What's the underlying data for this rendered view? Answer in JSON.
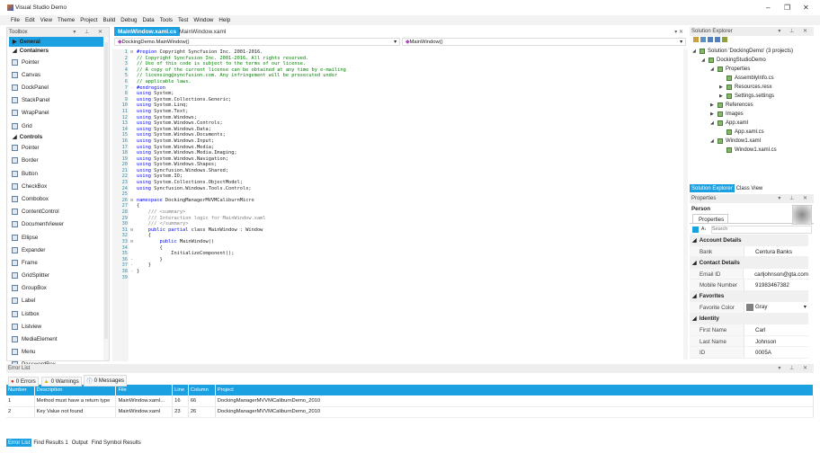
{
  "window": {
    "title": "Visual Studio Demo",
    "controls": [
      "–",
      "❐",
      "✕"
    ]
  },
  "menu": [
    "File",
    "Edit",
    "View",
    "Theme",
    "Project",
    "Build",
    "Debug",
    "Data",
    "Tools",
    "Test",
    "Window",
    "Help"
  ],
  "toolbox": {
    "title": "Toolbox",
    "items": [
      {
        "kind": "sel",
        "label": "General"
      },
      {
        "kind": "cat",
        "label": "Containers"
      },
      {
        "label": "Pointer",
        "icon": "pointer-icon"
      },
      {
        "label": "Canvas",
        "icon": "canvas-icon"
      },
      {
        "label": "DockPanel",
        "icon": "dockpanel-icon"
      },
      {
        "label": "StackPanel",
        "icon": "stackpanel-icon"
      },
      {
        "label": "WrapPanel",
        "icon": "wrappanel-icon"
      },
      {
        "label": "Grid",
        "icon": "grid-icon"
      },
      {
        "kind": "cat",
        "label": "Controls"
      },
      {
        "label": "Pointer",
        "icon": "pointer-icon"
      },
      {
        "label": "Border",
        "icon": "border-icon"
      },
      {
        "label": "Button",
        "icon": "button-icon"
      },
      {
        "label": "CheckBox",
        "icon": "checkbox-icon"
      },
      {
        "label": "Combobox",
        "icon": "combobox-icon"
      },
      {
        "label": "ContentControl",
        "icon": "contentcontrol-icon"
      },
      {
        "label": "DocumentViewer",
        "icon": "documentviewer-icon"
      },
      {
        "label": "Ellipse",
        "icon": "ellipse-icon"
      },
      {
        "label": "Expander",
        "icon": "expander-icon"
      },
      {
        "label": "Frame",
        "icon": "frame-icon"
      },
      {
        "label": "GridSplitter",
        "icon": "gridsplitter-icon"
      },
      {
        "label": "GroupBox",
        "icon": "groupbox-icon"
      },
      {
        "label": "Label",
        "icon": "label-icon"
      },
      {
        "label": "Listbox",
        "icon": "listbox-icon"
      },
      {
        "label": "Listview",
        "icon": "listview-icon"
      },
      {
        "label": "MediaElement",
        "icon": "mediaelement-icon"
      },
      {
        "label": "Menu",
        "icon": "menu-icon"
      },
      {
        "label": "PasswordBox",
        "icon": "passwordbox-icon"
      }
    ]
  },
  "editor": {
    "tabs": [
      "MainWindow.xaml.cs",
      "MainWindow.xaml"
    ],
    "type_combo": "DockingDemo.MainWindow()",
    "member_combo": "MainWindow()",
    "lines": [
      [
        [
          "#region",
          "pp"
        ],
        [
          " Copyright Syncfusion Inc. 2001-2016.",
          ""
        ]
      ],
      [
        [
          "// Copyright Syncfusion Inc. 2001-2016. All rights reserved.",
          "cm"
        ]
      ],
      [
        [
          "// Use of this code is subject to the terms of our license.",
          "cm"
        ]
      ],
      [
        [
          "// A copy of the current license can be obtained at any time by e-mailing",
          "cm"
        ]
      ],
      [
        [
          "// licensing@syncfusion.com. Any infringement will be prosecuted under",
          "cm"
        ]
      ],
      [
        [
          "// applicable laws.",
          "cm"
        ]
      ],
      [
        [
          "#endregion",
          "pp"
        ]
      ],
      [
        [
          "using",
          "kw"
        ],
        [
          " System;",
          ""
        ]
      ],
      [
        [
          "using",
          "kw"
        ],
        [
          " System.Collections.Generic;",
          ""
        ]
      ],
      [
        [
          "using",
          "kw"
        ],
        [
          " System.Linq;",
          ""
        ]
      ],
      [
        [
          "using",
          "kw"
        ],
        [
          " System.Text;",
          ""
        ]
      ],
      [
        [
          "using",
          "kw"
        ],
        [
          " System.Windows;",
          ""
        ]
      ],
      [
        [
          "using",
          "kw"
        ],
        [
          " System.Windows.Controls;",
          ""
        ]
      ],
      [
        [
          "using",
          "kw"
        ],
        [
          " System.Windows.Data;",
          ""
        ]
      ],
      [
        [
          "using",
          "kw"
        ],
        [
          " System.Windows.Documents;",
          ""
        ]
      ],
      [
        [
          "using",
          "kw"
        ],
        [
          " System.Windows.Input;",
          ""
        ]
      ],
      [
        [
          "using",
          "kw"
        ],
        [
          " System.Windows.Media;",
          ""
        ]
      ],
      [
        [
          "using",
          "kw"
        ],
        [
          " System.Windows.Media.Imaging;",
          ""
        ]
      ],
      [
        [
          "using",
          "kw"
        ],
        [
          " System.Windows.Navigation;",
          ""
        ]
      ],
      [
        [
          "using",
          "kw"
        ],
        [
          " System.Windows.Shapes;",
          ""
        ]
      ],
      [
        [
          "using",
          "kw"
        ],
        [
          " Syncfusion.Windows.Shared;",
          ""
        ]
      ],
      [
        [
          "using",
          "kw"
        ],
        [
          " System.IO;",
          ""
        ]
      ],
      [
        [
          "using",
          "kw"
        ],
        [
          " System.Collections.ObjectModel;",
          ""
        ]
      ],
      [
        [
          "using",
          "kw"
        ],
        [
          " Syncfusion.Windows.Tools.Controls;",
          ""
        ]
      ],
      [],
      [
        [
          "namespace",
          "kw"
        ],
        [
          " DockingManagerMVVMCaliburnMicro",
          ""
        ]
      ],
      [
        [
          "{",
          ""
        ]
      ],
      [
        [
          "    /// <summary>",
          "dc"
        ]
      ],
      [
        [
          "    /// Interaction logic for MainWindow.xaml",
          "dc"
        ]
      ],
      [
        [
          "    /// </summary>",
          "dc"
        ]
      ],
      [
        [
          "    ",
          ""
        ],
        [
          "public partial",
          "kw"
        ],
        [
          " class MainWindow : Window",
          ""
        ]
      ],
      [
        [
          "    {",
          ""
        ]
      ],
      [
        [
          "        ",
          ""
        ],
        [
          "public",
          "kw"
        ],
        [
          " MainWindow()",
          ""
        ]
      ],
      [
        [
          "        {",
          ""
        ]
      ],
      [
        [
          "            InitializeComponent();",
          ""
        ]
      ],
      [
        [
          "        }",
          ""
        ]
      ],
      [
        [
          "    }",
          ""
        ]
      ],
      [
        [
          "}",
          ""
        ]
      ],
      []
    ],
    "folds": {
      "1": "⊟",
      "7": "-",
      "26": "⊟",
      "31": "⊟",
      "33": "⊟",
      "36": "-",
      "37": "-",
      "38": "-"
    }
  },
  "solution_explorer": {
    "title": "Solution Explorer",
    "tree": [
      {
        "d": 0,
        "a": "◢",
        "label": "Solution 'DockingDemo' (3 projects)"
      },
      {
        "d": 1,
        "a": "◢",
        "label": "DockingStudioDemo"
      },
      {
        "d": 2,
        "a": "◢",
        "label": "Properties"
      },
      {
        "d": 3,
        "a": "",
        "label": "AssemblyInfo.cs"
      },
      {
        "d": 3,
        "a": "▶",
        "label": "Resources.resx"
      },
      {
        "d": 3,
        "a": "▶",
        "label": "Settings.settings"
      },
      {
        "d": 2,
        "a": "▶",
        "label": "References"
      },
      {
        "d": 2,
        "a": "▶",
        "label": "Images"
      },
      {
        "d": 2,
        "a": "◢",
        "label": "App.xaml"
      },
      {
        "d": 3,
        "a": "",
        "label": "App.xaml.cs"
      },
      {
        "d": 2,
        "a": "◢",
        "label": "Window1.xaml"
      },
      {
        "d": 3,
        "a": "",
        "label": "Window1.xaml.cs"
      }
    ],
    "tabs": [
      "Solution Explorer",
      "Class View"
    ]
  },
  "properties": {
    "title": "Properties",
    "object": "Person",
    "tab": "Properties",
    "search_placeholder": "Search",
    "groups": [
      {
        "name": "Account Details",
        "rows": [
          [
            "Bank",
            "Centura Banks"
          ]
        ]
      },
      {
        "name": "Contact Details",
        "rows": [
          [
            "Email ID",
            "carljohnson@gta.com"
          ],
          [
            "Mobile Number",
            "91983467382"
          ]
        ]
      },
      {
        "name": "Favorites",
        "rows": [
          [
            "Favorite Color",
            "Gray"
          ]
        ]
      },
      {
        "name": "Identity",
        "rows": [
          [
            "First Name",
            "Carl"
          ],
          [
            "Last Name",
            "Johnson"
          ],
          [
            "ID",
            "0005A"
          ]
        ]
      }
    ],
    "favorite_color_swatch": "#808080"
  },
  "error_list": {
    "title": "Error List",
    "filters": [
      "0 Errors",
      "0 Warnings",
      "0 Messages"
    ],
    "columns": [
      "Number",
      "Description",
      "File",
      "Line",
      "Column",
      "Project"
    ],
    "rows": [
      [
        "1",
        "Method must have a return type",
        "MainWindow.xaml...",
        "16",
        "66",
        "DockingManagerMVVMCaliburnDemo_2010"
      ],
      [
        "2",
        "Key Value not found",
        "MainWindow.xaml",
        "23",
        "26",
        "DockingManagerMVVMCaliburnDemo_2010"
      ]
    ],
    "bottom_tabs": [
      "Error List",
      "Find Results 1",
      "Output",
      "Find Symbol Results"
    ]
  },
  "colors": {
    "accent": "#1ba1e2"
  }
}
